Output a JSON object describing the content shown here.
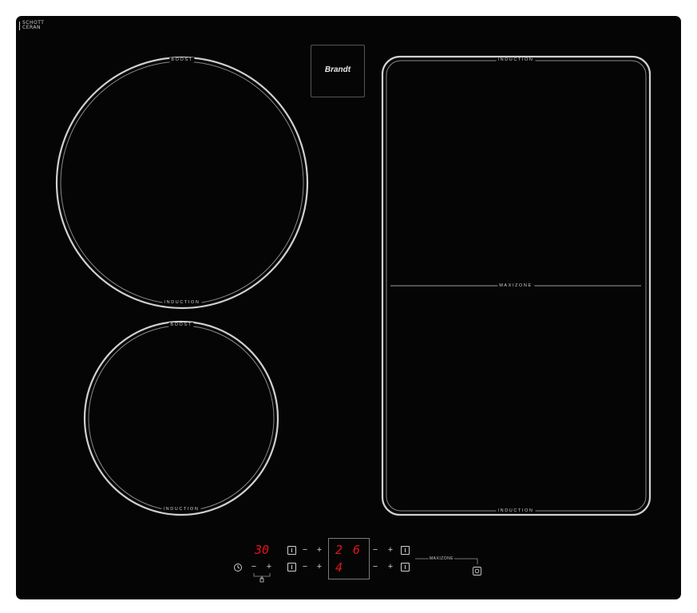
{
  "hob": {
    "brand": "Brandt",
    "glass_maker": {
      "line1": "SCHOTT",
      "line2": "CERAN"
    },
    "zones": {
      "top_left": {
        "top_label": "BOOST",
        "bottom_label": "INDUCTION"
      },
      "bottom_left": {
        "top_label": "BOOST",
        "bottom_label": "INDUCTION"
      },
      "right": {
        "top_label": "INDUCTION",
        "middle_label": "MAXIZONE",
        "bottom_label": "INDUCTION"
      }
    }
  },
  "controls": {
    "timer_display": "30",
    "zone_displays": {
      "front_left": "2",
      "rear_right": "6",
      "rear_left": "4"
    },
    "minus_symbol": "−",
    "plus_symbol": "+",
    "maxizone_label": "MAXIZONE",
    "icons": [
      "power-key-icon",
      "timer-clock-icon",
      "lock-icon",
      "maxizone-button-icon"
    ]
  },
  "colors": {
    "glass": "#050505",
    "outline": "#d0d0d0",
    "display": "#e0141e"
  }
}
